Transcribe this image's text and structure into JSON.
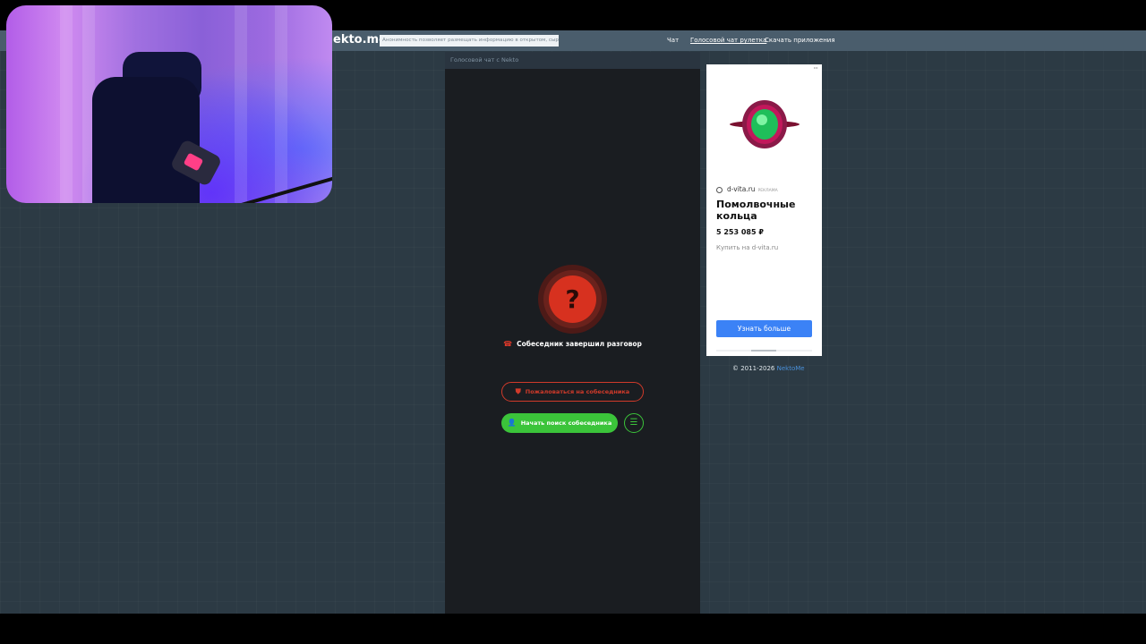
{
  "site": {
    "logo": "ekto.me",
    "notice": "Анонимность позволяет размещать информацию в открытом, сырой виде",
    "nav": [
      {
        "label": "Чат",
        "active": false
      },
      {
        "label": "Голосовой чат рулетка",
        "active": true
      },
      {
        "label": "Скачать приложения",
        "active": false
      }
    ]
  },
  "chat_panel": {
    "title": "Голосовой чат с Nekto",
    "avatar_symbol": "?",
    "status": "Собеседник завершил разговор",
    "report_button": "Пожаловаться на собеседника",
    "search_button": "Начать поиск собеседника",
    "icons": [
      "phone-hangup-icon",
      "shield-icon",
      "user-icon",
      "settings-sliders-icon"
    ]
  },
  "ad": {
    "menu": "···",
    "source": "d-vita.ru",
    "source_tag": "РЕКЛАМА",
    "title": "Помолвочные кольца",
    "price": "5 253 085 ₽",
    "cta_text": "Купить на d-vita.ru",
    "button": "Узнать больше"
  },
  "footer": {
    "copyright": "© 2011-2026",
    "link": "NektoMe"
  },
  "colors": {
    "accent_red": "#d7311f",
    "accent_green": "#3bc43a",
    "ad_button_blue": "#3b82f6",
    "page_bg": "#2c3a44"
  }
}
